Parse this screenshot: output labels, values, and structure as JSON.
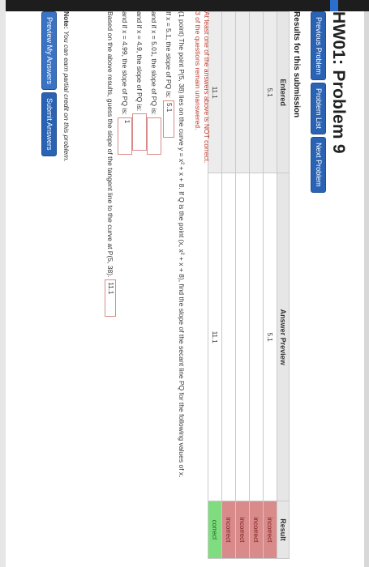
{
  "header": {
    "title": "HW01: Problem 9"
  },
  "nav": {
    "previous": "Previous Problem",
    "list": "Problem List",
    "next": "Next Problem"
  },
  "results": {
    "title": "Results for this submission",
    "columns": [
      "Entered",
      "Answer Preview",
      "Result"
    ],
    "rows": [
      {
        "entered": "5.1",
        "preview": "5.1",
        "result": "incorrect"
      },
      {
        "entered": "",
        "preview": "",
        "result": "incorrect"
      },
      {
        "entered": "",
        "preview": "",
        "result": "incorrect"
      },
      {
        "entered": "",
        "preview": "",
        "result": "incorrect"
      },
      {
        "entered": "11.1",
        "preview": "11.1",
        "result": "correct"
      }
    ],
    "warning_1": "At least one of the answers above is NOT correct.",
    "warning_2": "3 of the questions remain unanswered."
  },
  "problem": {
    "intro": "(1 point) The point P(5, 38) lies on the curve y = x² + x + 8. If Q is the point (x, x² + x + 8), find the slope of the secant line PQ for the following values of x.",
    "l1": "If x = 5.1, the slope of PQ is:",
    "a1": "5.1",
    "l2": "and if x = 5.01, the slope of PQ is:",
    "a2": "",
    "l3": "and if x = 4.9, the slope of PQ is:",
    "a3": "",
    "l4": "and if x = 4.99, the slope of PQ is:",
    "a4": "1",
    "conclusion": "Based on the above results, guess the slope of the tangent line to the curve at P(5, 38).",
    "a5": "11.1"
  },
  "note": {
    "label": "Note:",
    "text": "You can earn partial credit on this problem."
  },
  "actions": {
    "preview": "Preview My Answers",
    "submit": "Submit Answers"
  }
}
